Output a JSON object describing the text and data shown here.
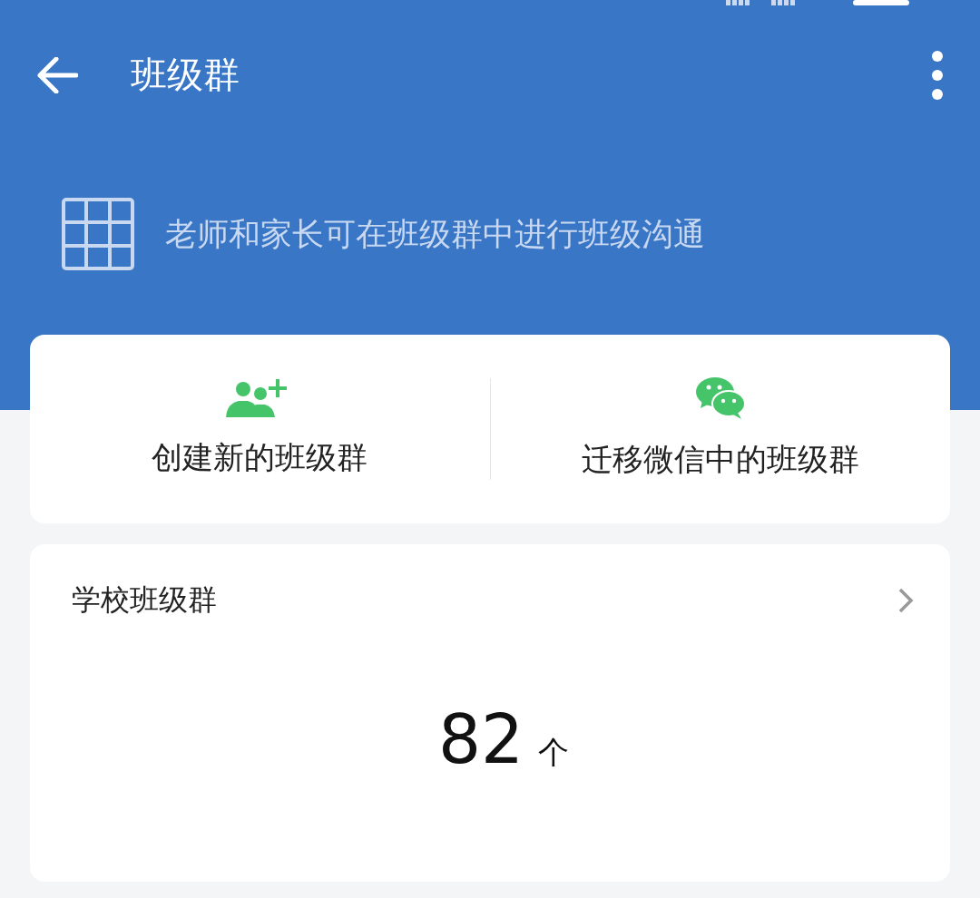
{
  "top_bar": {
    "title": "班级群"
  },
  "banner": {
    "text": "老师和家长可在班级群中进行班级沟通"
  },
  "actions": [
    {
      "kind": "add-group",
      "label": "创建新的班级群"
    },
    {
      "kind": "chat",
      "label": "迁移微信中的班级群"
    }
  ],
  "school_groups": {
    "title": "学校班级群",
    "count": "82",
    "unit": "个"
  }
}
